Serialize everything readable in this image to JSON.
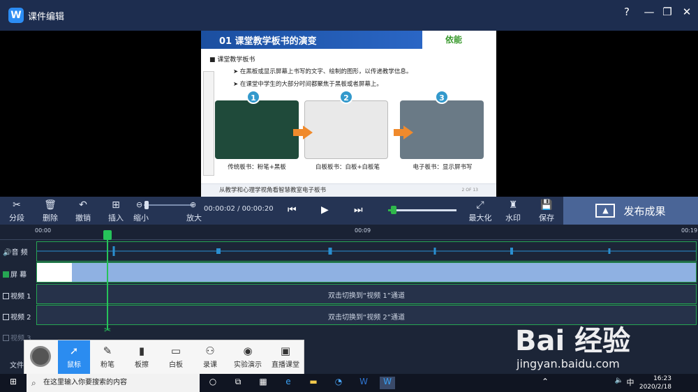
{
  "app": {
    "title": "课件编辑",
    "logo": "W"
  },
  "window": {
    "help": "?",
    "minimize": "—",
    "restore": "❐",
    "close": "✕"
  },
  "slide": {
    "title": "01 课堂教学板书的演变",
    "brand": "依能",
    "section": "课堂教学板书",
    "bullets": [
      "在黑板或显示屏幕上书写的文字、绘制的图形，以传递教学信息。",
      "在课堂中学生的大部分时间都聚焦于黑板或者屏幕上。"
    ],
    "numbers": [
      "1",
      "2",
      "3"
    ],
    "captions": [
      "传统板书：粉笔+黑板",
      "白板板书：白板+白板笔",
      "电子板书：显示屏书写"
    ],
    "footer": "从教学和心理学视角看智慧教室电子板书",
    "page": "2 OF 13"
  },
  "toolbar": {
    "split": "分段",
    "delete": "删除",
    "undo": "撤销",
    "insert": "插入",
    "zoom_out": "缩小",
    "zoom_in": "放大",
    "time": "00:00:02 / 00:00:20",
    "maximize": "最大化",
    "watermark": "水印",
    "save": "保存",
    "publish": "发布成果"
  },
  "ruler": [
    "00:00",
    "00:09",
    "00:19"
  ],
  "tracks": {
    "audio": "音 频",
    "screen": "屏 幕",
    "video1": "视频 1",
    "video2": "视频 2",
    "video3": "视频 3",
    "video1_msg": "双击切换到“视频 1”通道",
    "video2_msg": "双击切换到“视频 2”通道"
  },
  "floatbar": {
    "mouse": "鼠标",
    "chalk": "粉笔",
    "eraser": "板擦",
    "whiteboard": "白板",
    "record": "录课",
    "demo": "实验演示",
    "live": "直播课堂"
  },
  "footer_text": "文件",
  "taskbar": {
    "search_placeholder": "在这里输入你要搜索的内容",
    "time": "16:23",
    "date": "2020/2/18",
    "ime": "中"
  },
  "watermark": {
    "brand": "Bai 经验",
    "url": "jingyan.baidu.com"
  }
}
